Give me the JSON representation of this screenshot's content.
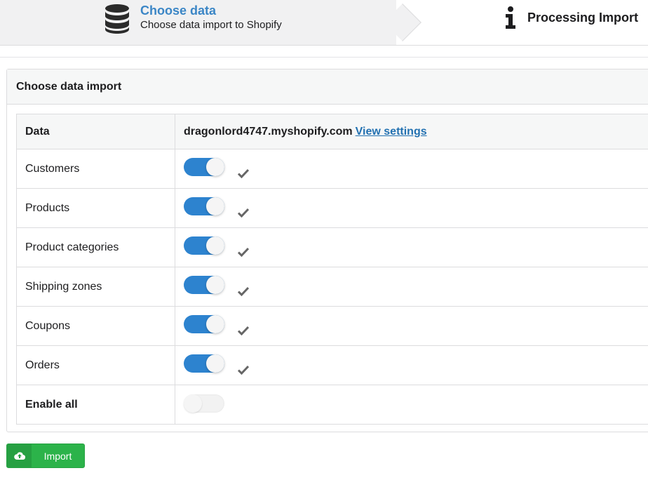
{
  "steps": {
    "active": {
      "icon": "database-icon",
      "title": "Choose data",
      "subtitle": "Choose data import to Shopify"
    },
    "next": {
      "icon": "info-icon",
      "title": "Processing Import"
    }
  },
  "panel": {
    "title": "Choose data import"
  },
  "table": {
    "header_label": "Data",
    "domain": "dragonlord4747.myshopify.com",
    "view_settings_link": "View settings",
    "rows": [
      {
        "label": "Customers",
        "enabled": true
      },
      {
        "label": "Products",
        "enabled": true
      },
      {
        "label": "Product categories",
        "enabled": true
      },
      {
        "label": "Shipping zones",
        "enabled": true
      },
      {
        "label": "Coupons",
        "enabled": true
      },
      {
        "label": "Orders",
        "enabled": true
      }
    ],
    "enable_all": {
      "label": "Enable all",
      "enabled": false
    }
  },
  "import_button": {
    "icon": "cloud-upload-icon",
    "label": "Import"
  },
  "colors": {
    "accent": "#3b86c6",
    "toggle_on": "#2d83cf",
    "import_green": "#2cb34a",
    "link": "#2271b1"
  }
}
